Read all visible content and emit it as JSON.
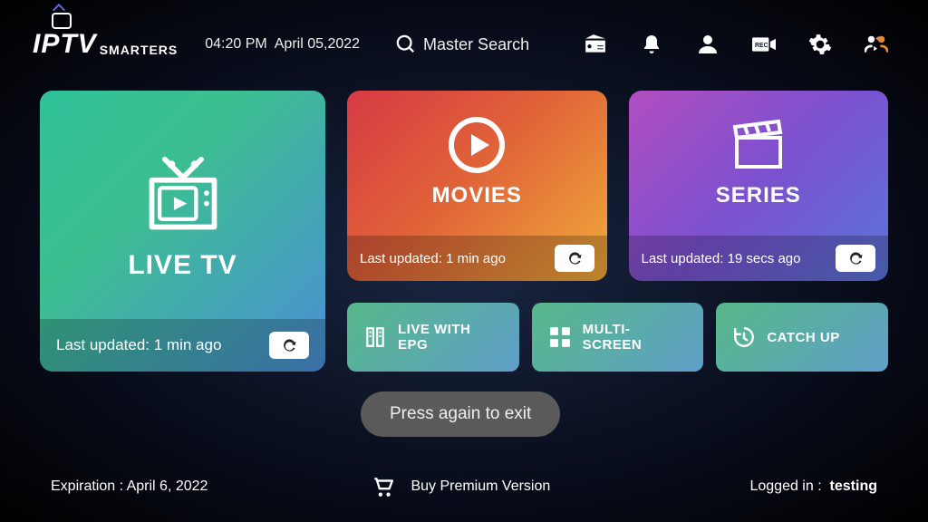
{
  "header": {
    "logo_main": "IPTV",
    "logo_sub": "SMARTERS",
    "time": "04:20 PM",
    "date": "April 05,2022",
    "search_label": "Master Search"
  },
  "live_tv": {
    "title": "LIVE TV",
    "updated": "Last updated: 1 min ago"
  },
  "movies": {
    "title": "MOVIES",
    "updated": "Last updated: 1 min ago"
  },
  "series": {
    "title": "SERIES",
    "updated": "Last updated: 19 secs ago"
  },
  "small_cards": {
    "epg": "LIVE WITH EPG",
    "multi": "MULTI-SCREEN",
    "catchup": "CATCH UP"
  },
  "footer": {
    "expiration": "Expiration : April 6, 2022",
    "buy": "Buy Premium Version",
    "logged_label": "Logged in :",
    "logged_user": "testing"
  },
  "toast": "Press again to exit"
}
